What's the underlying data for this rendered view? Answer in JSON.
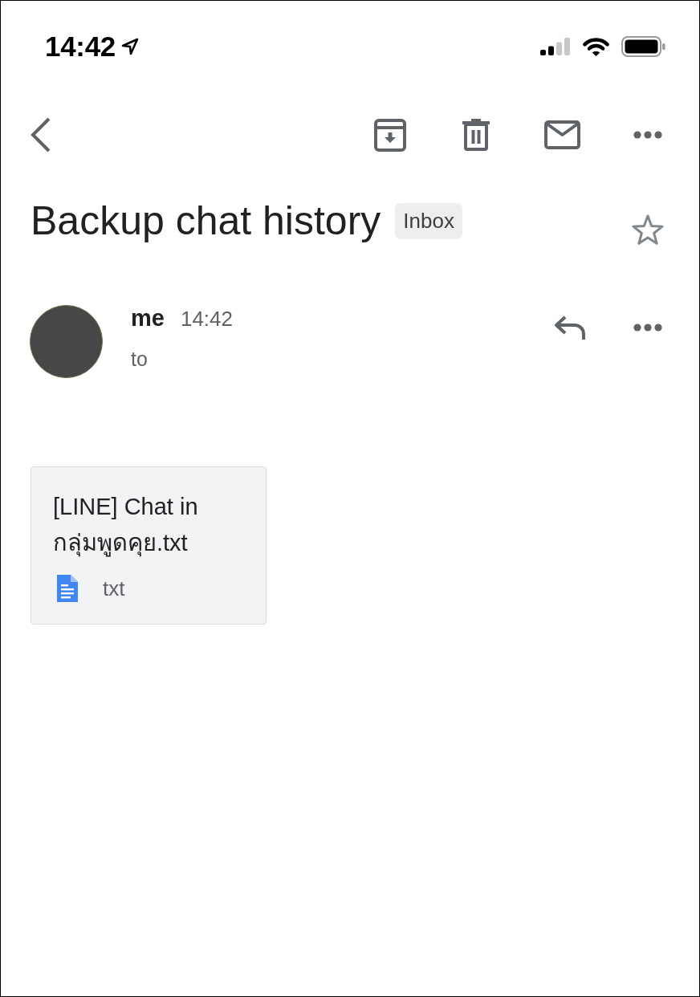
{
  "status_bar": {
    "time": "14:42"
  },
  "email": {
    "subject": "Backup chat history",
    "label": "Inbox",
    "starred": false
  },
  "message": {
    "sender": "me",
    "time": "14:42",
    "recipients": "to"
  },
  "attachments": [
    {
      "name": "[LINE] Chat in กลุ่มพูดคุย.txt",
      "type": "txt"
    }
  ]
}
